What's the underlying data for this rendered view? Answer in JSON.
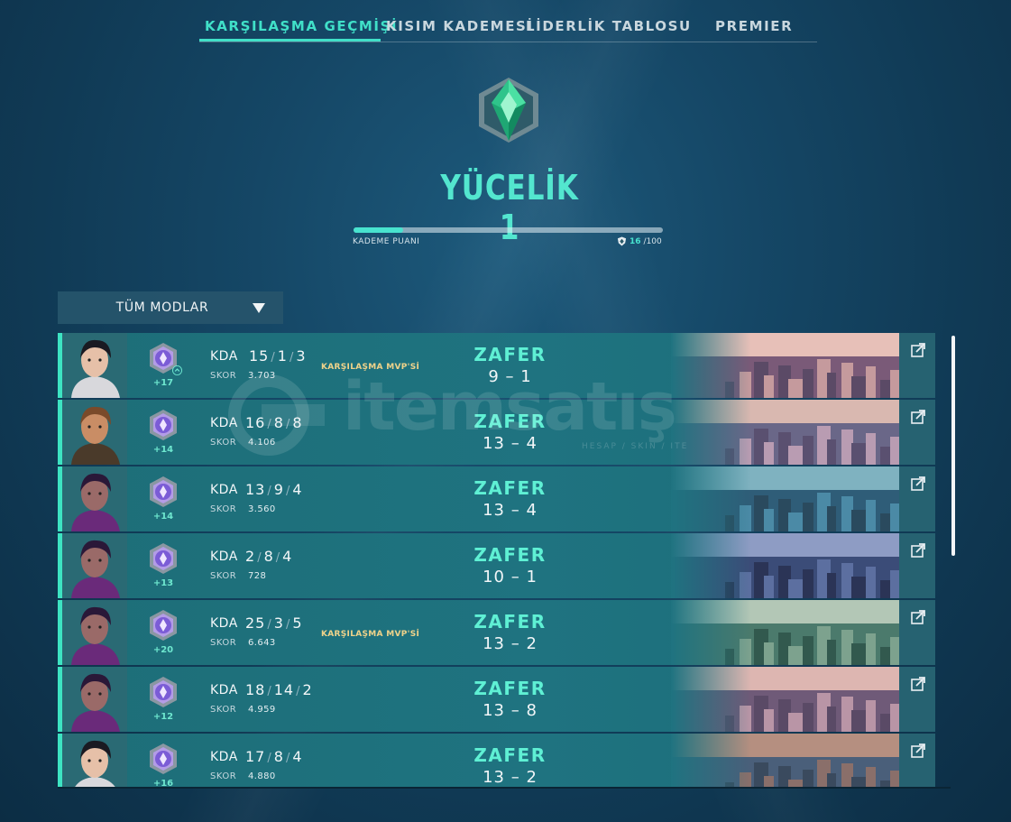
{
  "nav": {
    "tabs": [
      {
        "label": "KARŞILAŞMA GEÇMİŞİ",
        "active": true
      },
      {
        "label": "KISIM KADEMESİ",
        "active": false
      },
      {
        "label": "LİDERLİK TABLOSU",
        "active": false
      },
      {
        "label": "PREMIER",
        "active": false
      }
    ]
  },
  "rank": {
    "name": "YÜCELİK 1",
    "emblem": "ascendant-rank-icon",
    "progress_label": "KADEME PUANI",
    "rr_current": "16",
    "rr_max": "/100",
    "rr_fraction": 0.16
  },
  "filter": {
    "label": "TÜM MODLAR"
  },
  "colors": {
    "accent": "#40e0c8",
    "win": "#5ff0d4",
    "mvp": "#f0d38a",
    "row_bg": "#1f7380"
  },
  "matches": [
    {
      "agent": "agent-portrait-sage-icon",
      "rr_gain": "+17",
      "kda_label": "KDA",
      "k": "15",
      "d": "1",
      "a": "3",
      "score_label": "SKOR",
      "score": "3.703",
      "mvp": "KARŞILAŞMA MVP'Sİ",
      "result": "ZAFER",
      "team_score": "9 – 1"
    },
    {
      "agent": "agent-portrait-brimstone-icon",
      "rr_gain": "+14",
      "kda_label": "KDA",
      "k": "16",
      "d": "8",
      "a": "8",
      "score_label": "SKOR",
      "score": "4.106",
      "mvp": "",
      "result": "ZAFER",
      "team_score": "13 – 4"
    },
    {
      "agent": "agent-portrait-reyna-icon",
      "rr_gain": "+14",
      "kda_label": "KDA",
      "k": "13",
      "d": "9",
      "a": "4",
      "score_label": "SKOR",
      "score": "3.560",
      "mvp": "",
      "result": "ZAFER",
      "team_score": "13 – 4"
    },
    {
      "agent": "agent-portrait-reyna-icon",
      "rr_gain": "+13",
      "kda_label": "KDA",
      "k": "2",
      "d": "8",
      "a": "4",
      "score_label": "SKOR",
      "score": "728",
      "mvp": "",
      "result": "ZAFER",
      "team_score": "10 – 1"
    },
    {
      "agent": "agent-portrait-reyna-icon",
      "rr_gain": "+20",
      "kda_label": "KDA",
      "k": "25",
      "d": "3",
      "a": "5",
      "score_label": "SKOR",
      "score": "6.643",
      "mvp": "KARŞILAŞMA MVP'Sİ",
      "result": "ZAFER",
      "team_score": "13 – 2"
    },
    {
      "agent": "agent-portrait-reyna-icon",
      "rr_gain": "+12",
      "kda_label": "KDA",
      "k": "18",
      "d": "14",
      "a": "2",
      "score_label": "SKOR",
      "score": "4.959",
      "mvp": "",
      "result": "ZAFER",
      "team_score": "13 – 8"
    },
    {
      "agent": "agent-portrait-sage-icon",
      "rr_gain": "+16",
      "kda_label": "KDA",
      "k": "17",
      "d": "8",
      "a": "4",
      "score_label": "SKOR",
      "score": "4.880",
      "mvp": "",
      "result": "ZAFER",
      "team_score": "13 – 2"
    }
  ],
  "watermark": {
    "text": "itemsatış",
    "sub": "HESAP / SKIN / ITE"
  }
}
